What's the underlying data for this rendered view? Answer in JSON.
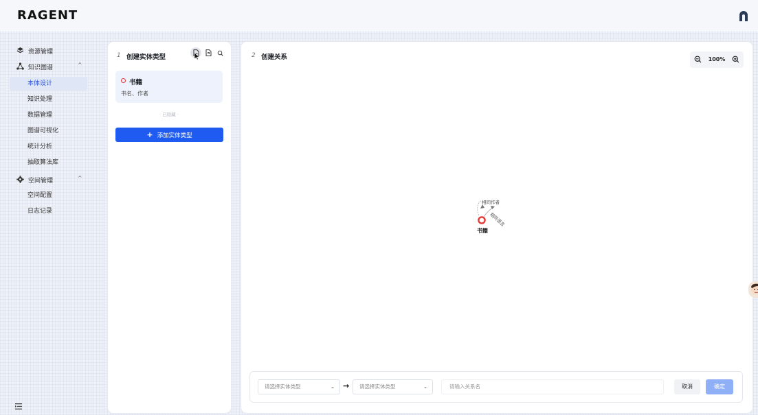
{
  "app": {
    "logo": "RAGENT"
  },
  "sidebar": {
    "groups": [
      {
        "label": "资源管理"
      },
      {
        "label": "知识图谱",
        "caret": "^"
      },
      {
        "label": "空间管理",
        "caret": "^"
      }
    ],
    "items": [
      {
        "label": "本体设计",
        "active": true
      },
      {
        "label": "知识处理"
      },
      {
        "label": "数据管理"
      },
      {
        "label": "图谱可视化"
      },
      {
        "label": "统计分析"
      },
      {
        "label": "抽取算法库"
      },
      {
        "label": "空间配置"
      },
      {
        "label": "日志记录"
      }
    ]
  },
  "left_panel": {
    "step": "1",
    "title": "创建实体类型",
    "entity": {
      "name": "书籍",
      "attributes": "书名、作者"
    },
    "hidden_label": "· 已隐藏 ·",
    "add_button": "添加实体类型"
  },
  "right_panel": {
    "step": "2",
    "title": "创建关系",
    "zoom": "100%",
    "graph": {
      "node": "书籍",
      "edges": [
        "相同作者",
        "相同语言"
      ]
    },
    "form": {
      "source_placeholder": "请选择实体类型",
      "target_placeholder": "请选择实体类型",
      "relation_placeholder": "请输入关系名",
      "cancel": "取消",
      "confirm": "确定"
    }
  },
  "colors": {
    "accent": "#1f5bf0",
    "node_ring": "#e53935",
    "confirm_disabled": "#8fb0f7"
  }
}
